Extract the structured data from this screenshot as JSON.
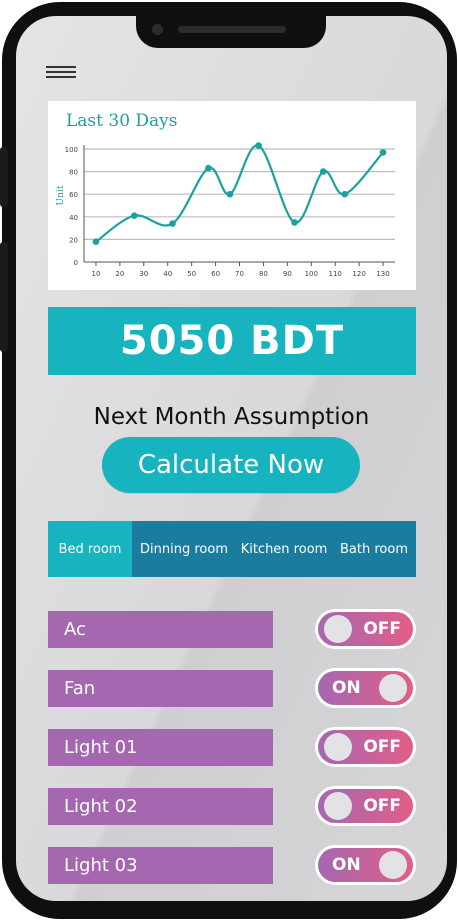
{
  "chart": {
    "title": "Last 30 Days",
    "ylabel": "Unit"
  },
  "chart_data": {
    "type": "line",
    "title": "Last 30 Days",
    "xlabel": "",
    "ylabel": "Unit",
    "x_ticks": [
      10,
      20,
      30,
      40,
      50,
      60,
      70,
      80,
      90,
      100,
      110,
      120,
      130
    ],
    "y_ticks": [
      0,
      20,
      40,
      60,
      80,
      100
    ],
    "xlim": [
      5,
      135
    ],
    "ylim": [
      0,
      100
    ],
    "grid": true,
    "series": [
      {
        "x": [
          10,
          26,
          42,
          57,
          66,
          78,
          93,
          105,
          114,
          130
        ],
        "y": [
          18,
          41,
          34,
          83,
          60,
          103,
          35,
          80,
          60,
          97
        ]
      }
    ],
    "colors": {
      "line": "#1aa39d",
      "grid": "#bdbdbd",
      "axis": "#555555"
    }
  },
  "amount": {
    "value": "5050 BDT"
  },
  "assumption": {
    "label": "Next Month Assumption"
  },
  "calculate": {
    "label": "Calculate Now"
  },
  "rooms": {
    "tabs": [
      {
        "label": "Bed room",
        "active": true
      },
      {
        "label": "Dinning room",
        "active": false
      },
      {
        "label": "Kitchen room",
        "active": false
      },
      {
        "label": "Bath room",
        "active": false
      }
    ]
  },
  "devices": [
    {
      "name": "Ac",
      "state": "OFF"
    },
    {
      "name": "Fan",
      "state": "ON"
    },
    {
      "name": "Light 01",
      "state": "OFF"
    },
    {
      "name": "Light 02",
      "state": "OFF"
    },
    {
      "name": "Light 03",
      "state": "ON"
    }
  ],
  "colors": {
    "accent": "#17b4bf",
    "tab_bar": "#1a7c9f",
    "device_label": "#a568b0",
    "toggle_end": "#e25e88"
  }
}
